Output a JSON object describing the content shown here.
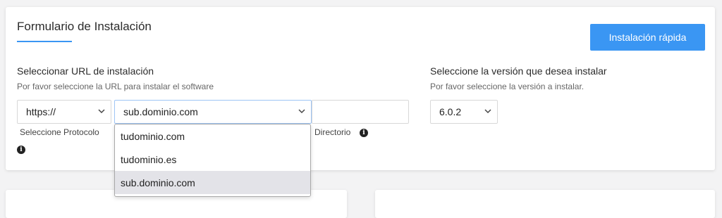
{
  "form": {
    "title": "Formulario de Instalación",
    "quick_install_label": "Instalación rápida"
  },
  "url_section": {
    "label": "Seleccionar URL de instalación",
    "hint": "Por favor seleccione la URL para instalar el software",
    "protocol_value": "https://",
    "protocol_caption": "Seleccione Protocolo",
    "domain_value": "sub.dominio.com",
    "directory_value": "",
    "directory_caption": "Directorio",
    "domain_options": [
      "tudominio.com",
      "tudominio.es",
      "sub.dominio.com"
    ],
    "selected_domain": "sub.dominio.com"
  },
  "version_section": {
    "label": "Seleccione la versión que desea instalar",
    "hint": "Por favor seleccione la versión a instalar.",
    "version_value": "6.0.2"
  },
  "icons": {
    "info": "info-icon",
    "dropdown": "chevron-down-icon"
  },
  "colors": {
    "accent": "#3a96f3",
    "selected_option_bg": "#e3e3e8"
  }
}
